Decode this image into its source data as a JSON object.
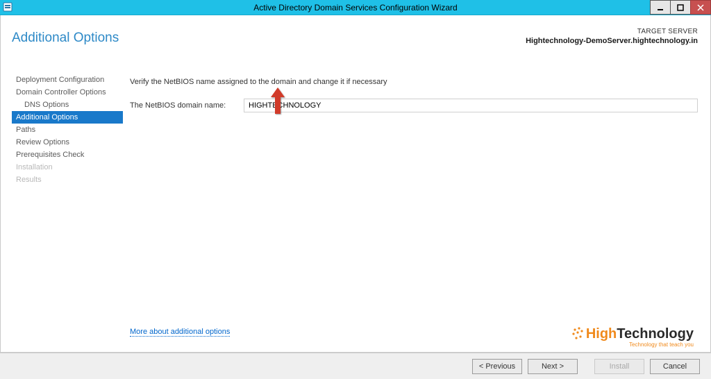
{
  "window": {
    "title": "Active Directory Domain Services Configuration Wizard"
  },
  "header": {
    "page_title": "Additional Options",
    "target_label": "TARGET SERVER",
    "target_value": "Hightechnology-DemoServer.hightechnology.in"
  },
  "sidebar": {
    "items": [
      {
        "label": "Deployment Configuration",
        "indent": false,
        "disabled": false
      },
      {
        "label": "Domain Controller Options",
        "indent": false,
        "disabled": false
      },
      {
        "label": "DNS Options",
        "indent": true,
        "disabled": false
      },
      {
        "label": "Additional Options",
        "indent": false,
        "disabled": false
      },
      {
        "label": "Paths",
        "indent": false,
        "disabled": false
      },
      {
        "label": "Review Options",
        "indent": false,
        "disabled": false
      },
      {
        "label": "Prerequisites Check",
        "indent": false,
        "disabled": false
      },
      {
        "label": "Installation",
        "indent": false,
        "disabled": true
      },
      {
        "label": "Results",
        "indent": false,
        "disabled": true
      }
    ],
    "selected_index": 3
  },
  "main": {
    "instruction": "Verify the NetBIOS name assigned to the domain and change it if necessary",
    "netbios_label": "The NetBIOS domain name:",
    "netbios_value": "HIGHTECHNOLOGY",
    "more_link": "More about additional options"
  },
  "footer": {
    "previous": "< Previous",
    "next": "Next >",
    "install": "Install",
    "cancel": "Cancel"
  },
  "branding": {
    "logo_text_pre": "High",
    "logo_text_post": "Technology",
    "tagline": "Technology that teach you"
  }
}
